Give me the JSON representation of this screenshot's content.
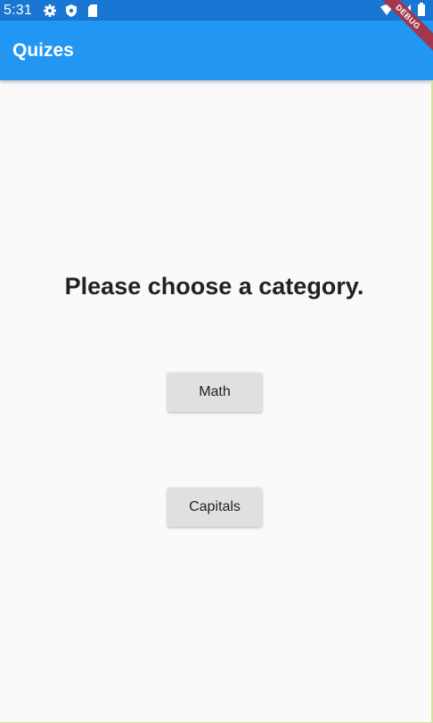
{
  "status_bar": {
    "time": "5:31",
    "left_icons": [
      "gear-icon",
      "shield-icon",
      "sd-card-icon"
    ],
    "right_icons": [
      "wifi-icon",
      "signal-icon",
      "battery-icon"
    ],
    "color": "#1976d2"
  },
  "app_bar": {
    "title": "Quizes",
    "color": "#2196f3"
  },
  "debug_banner": {
    "label": "DEBUG"
  },
  "main": {
    "heading": "Please choose a category.",
    "categories": [
      {
        "label": "Math"
      },
      {
        "label": "Capitals"
      }
    ]
  }
}
